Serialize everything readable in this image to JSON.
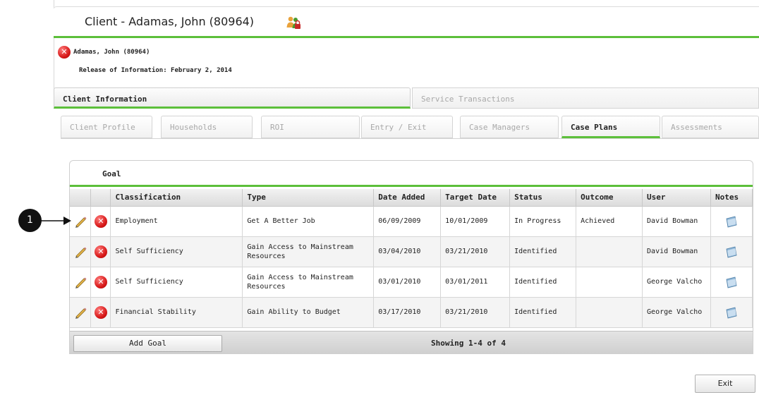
{
  "client_header": {
    "title": "Client - Adamas, John (80964)",
    "icon": "people-lock-icon"
  },
  "client_info": {
    "name": "Adamas, John (80964)",
    "release": "Release of Information: February 2, 2014"
  },
  "main_tabs": [
    {
      "label": "Client Information",
      "active": true
    },
    {
      "label": "Service Transactions",
      "active": false
    }
  ],
  "sub_tabs": [
    {
      "label": "Client Profile",
      "active": false
    },
    {
      "label": "Households",
      "active": false
    },
    {
      "label": "ROI",
      "active": false
    },
    {
      "label": "Entry / Exit",
      "active": false
    },
    {
      "label": "Case Managers",
      "active": false
    },
    {
      "label": "Case Plans",
      "active": true
    },
    {
      "label": "Assessments",
      "active": false
    }
  ],
  "goal_panel": {
    "title": "Goal",
    "columns": [
      "",
      "",
      "Classification",
      "Type",
      "Date Added",
      "Target Date",
      "Status",
      "Outcome",
      "User",
      "Notes"
    ],
    "rows": [
      {
        "classification": "Employment",
        "type": "Get A Better Job",
        "date_added": "06/09/2009",
        "target_date": "10/01/2009",
        "status": "In Progress",
        "outcome": "Achieved",
        "user": "David Bowman"
      },
      {
        "classification": "Self Sufficiency",
        "type": "Gain Access to Mainstream Resources",
        "date_added": "03/04/2010",
        "target_date": "03/21/2010",
        "status": "Identified",
        "outcome": "",
        "user": "David Bowman"
      },
      {
        "classification": "Self Sufficiency",
        "type": "Gain Access to Mainstream Resources",
        "date_added": "03/01/2010",
        "target_date": "03/01/2011",
        "status": "Identified",
        "outcome": "",
        "user": "George Valcho"
      },
      {
        "classification": "Financial Stability",
        "type": "Gain Ability to Budget",
        "date_added": "03/17/2010",
        "target_date": "03/21/2010",
        "status": "Identified",
        "outcome": "",
        "user": "George Valcho"
      }
    ],
    "add_button_label": "Add Goal",
    "showing_text": "Showing 1-4 of 4"
  },
  "exit_label": "Exit",
  "callout": {
    "number": "1"
  },
  "colors": {
    "accent_green": "#5cbf3a",
    "delete_red": "#d81b1b"
  }
}
